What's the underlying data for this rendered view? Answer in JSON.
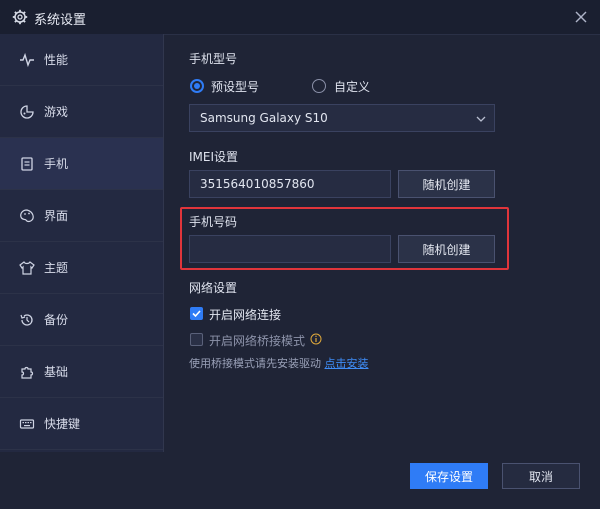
{
  "window": {
    "title": "系统设置"
  },
  "sidebar": {
    "items": [
      {
        "label": "性能",
        "icon": "pulse-icon",
        "active": false
      },
      {
        "label": "游戏",
        "icon": "gamepad-icon",
        "active": false
      },
      {
        "label": "手机",
        "icon": "phone-icon",
        "active": true
      },
      {
        "label": "界面",
        "icon": "palette-icon",
        "active": false
      },
      {
        "label": "主题",
        "icon": "shirt-icon",
        "active": false
      },
      {
        "label": "备份",
        "icon": "history-icon",
        "active": false
      },
      {
        "label": "基础",
        "icon": "puzzle-icon",
        "active": false
      },
      {
        "label": "快捷键",
        "icon": "keyboard-icon",
        "active": false
      }
    ]
  },
  "phone_model": {
    "title": "手机型号",
    "option_preset": "预设型号",
    "option_custom": "自定义",
    "selected": "预设型号",
    "model_value": "Samsung Galaxy S10"
  },
  "imei": {
    "title": "IMEI设置",
    "value": "351564010857860",
    "random_button": "随机创建"
  },
  "phone_number": {
    "title": "手机号码",
    "value": "",
    "random_button": "随机创建"
  },
  "network": {
    "title": "网络设置",
    "enable_network": "开启网络连接",
    "enable_network_checked": true,
    "bridge_mode": "开启网络桥接模式",
    "bridge_mode_checked": false,
    "note_text": "使用桥接模式请先安装驱动",
    "note_link": "点击安装"
  },
  "footer": {
    "save_button": "保存设置",
    "cancel_button": "取消"
  },
  "colors": {
    "accent": "#2f7cf6",
    "highlight": "#e0353b"
  }
}
